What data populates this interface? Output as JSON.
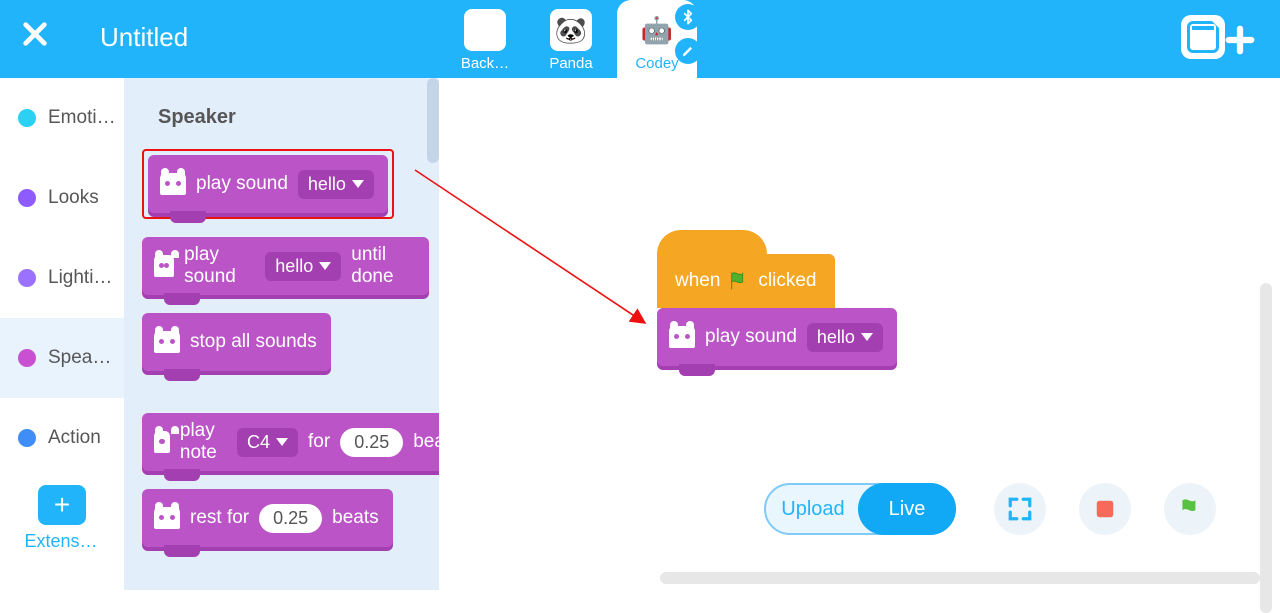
{
  "header": {
    "title": "Untitled",
    "tabs": [
      {
        "label": "Back…",
        "icon": ""
      },
      {
        "label": "Panda",
        "icon": "🐼"
      },
      {
        "label": "Codey",
        "icon": "🤖"
      }
    ],
    "active_tab": 2
  },
  "sidebar": {
    "categories": [
      {
        "label": "Emoti…",
        "color": "#2ad1f2"
      },
      {
        "label": "Looks",
        "color": "#8d5bff"
      },
      {
        "label": "Lighti…",
        "color": "#9b71ff"
      },
      {
        "label": "Spea…",
        "color": "#c951d1"
      },
      {
        "label": "Action",
        "color": "#3f8ef7"
      }
    ],
    "active": 3,
    "extension_label": "Extensi…"
  },
  "palette": {
    "heading": "Speaker",
    "blocks": {
      "play_sound": {
        "label": "play sound",
        "option": "hello"
      },
      "play_sound_until": {
        "label": "play sound",
        "option": "hello",
        "suffix": "until done"
      },
      "stop_sounds": {
        "label": "stop all sounds"
      },
      "play_note": {
        "label": "play note",
        "note": "C4",
        "mid": "for",
        "beats": "0.25",
        "suffix": "beats"
      },
      "rest": {
        "label": "rest for",
        "beats": "0.25",
        "suffix": "beats"
      }
    }
  },
  "workspace": {
    "hat": {
      "prefix": "when",
      "suffix": "clicked"
    },
    "block": {
      "label": "play sound",
      "option": "hello"
    }
  },
  "footer": {
    "mode_upload": "Upload",
    "mode_live": "Live",
    "live_active": true
  },
  "colors": {
    "accent": "#22b4fb",
    "block_body": "#bb55c7",
    "block_shade": "#a43fb1",
    "hat": "#f5a623"
  }
}
